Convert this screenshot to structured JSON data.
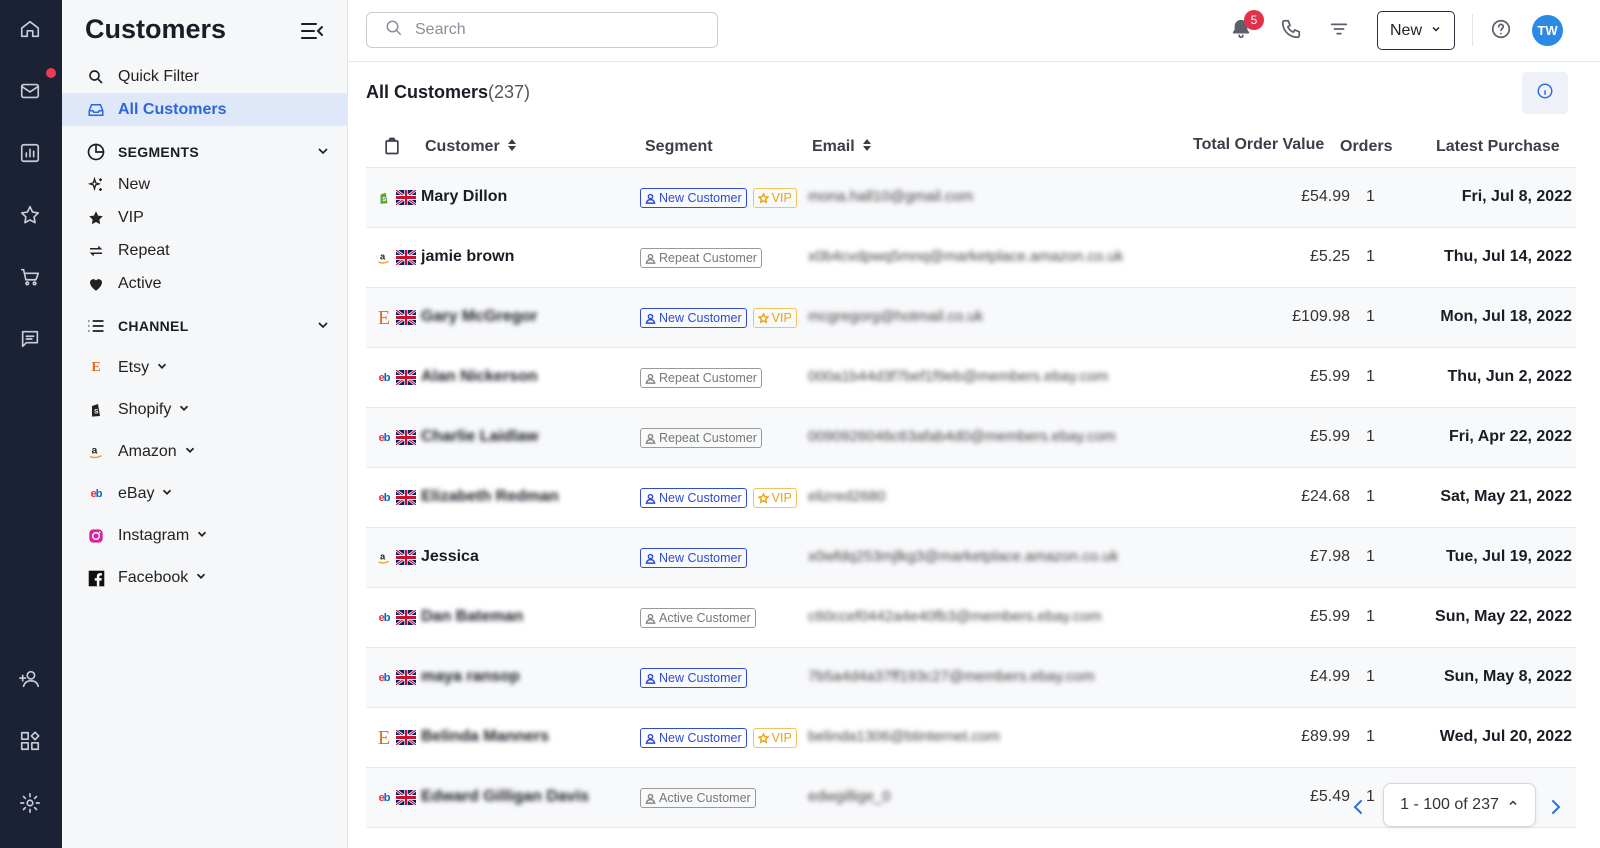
{
  "sidebar": {
    "title": "Customers",
    "quick_filter": "Quick Filter",
    "all_customers": "All Customers",
    "segments_label": "SEGMENTS",
    "segments": [
      "New",
      "VIP",
      "Repeat",
      "Active"
    ],
    "channel_label": "CHANNEL",
    "channels": [
      "Etsy",
      "Shopify",
      "Amazon",
      "eBay",
      "Instagram",
      "Facebook"
    ]
  },
  "topbar": {
    "search_placeholder": "Search",
    "notification_count": "5",
    "new_label": "New",
    "avatar_initials": "TW"
  },
  "main": {
    "heading": "All Customers",
    "count": "(237)",
    "columns": {
      "customer": "Customer",
      "segment": "Segment",
      "email": "Email",
      "total": "Total Order Value",
      "orders": "Orders",
      "latest": "Latest Purchase"
    },
    "rows": [
      {
        "channel": "shopify",
        "name": "Mary Dillon",
        "name_blur": false,
        "segments": [
          "New Customer",
          "VIP"
        ],
        "email": "mona.hall10@gmail.com",
        "total": "£54.99",
        "orders": "1",
        "latest": "Fri, Jul 8, 2022"
      },
      {
        "channel": "amazon",
        "name": "jamie brown",
        "name_blur": false,
        "segments": [
          "Repeat Customer"
        ],
        "email": "x0b4cvdpwq5mnq@marketplace.amazon.co.uk",
        "total": "£5.25",
        "orders": "1",
        "latest": "Thu, Jul 14, 2022"
      },
      {
        "channel": "etsy",
        "name": "Gary McGregor",
        "name_blur": true,
        "segments": [
          "New Customer",
          "VIP"
        ],
        "email": "mcgregorg@hotmail.co.uk",
        "total": "£109.98",
        "orders": "1",
        "latest": "Mon, Jul 18, 2022"
      },
      {
        "channel": "ebay",
        "name": "Alan Nickerson",
        "name_blur": true,
        "segments": [
          "Repeat Customer"
        ],
        "email": "000a1b44d3f7bef1f9eb@members.ebay.com",
        "total": "£5.99",
        "orders": "1",
        "latest": "Thu, Jun 2, 2022"
      },
      {
        "channel": "ebay",
        "name": "Charlie Laidlaw",
        "name_blur": true,
        "segments": [
          "Repeat Customer"
        ],
        "email": "0090926046c63afab4d0@members.ebay.com",
        "total": "£5.99",
        "orders": "1",
        "latest": "Fri, Apr 22, 2022"
      },
      {
        "channel": "ebay",
        "name": "Elizabeth Redman",
        "name_blur": true,
        "segments": [
          "New Customer",
          "VIP"
        ],
        "email": "elizred2680",
        "total": "£24.68",
        "orders": "1",
        "latest": "Sat, May 21, 2022"
      },
      {
        "channel": "amazon",
        "name": "Jessica",
        "name_blur": false,
        "segments": [
          "New Customer"
        ],
        "email": "x0wfdq253mjlkg3@marketplace.amazon.co.uk",
        "total": "£7.98",
        "orders": "1",
        "latest": "Tue, Jul 19, 2022"
      },
      {
        "channel": "ebay",
        "name": "Dan Bateman",
        "name_blur": true,
        "segments": [
          "Active Customer"
        ],
        "email": "c60ccef0442a4e40fb3@members.ebay.com",
        "total": "£5.99",
        "orders": "1",
        "latest": "Sun, May 22, 2022"
      },
      {
        "channel": "ebay",
        "name": "maya ransop",
        "name_blur": true,
        "segments": [
          "New Customer"
        ],
        "email": "7b5a4d4a37ff193c27@members.ebay.com",
        "total": "£4.99",
        "orders": "1",
        "latest": "Sun, May 8, 2022"
      },
      {
        "channel": "etsy",
        "name": "Belinda Manners",
        "name_blur": true,
        "segments": [
          "New Customer",
          "VIP"
        ],
        "email": "belinda1306@btinternet.com",
        "total": "£89.99",
        "orders": "1",
        "latest": "Wed, Jul 20, 2022"
      },
      {
        "channel": "ebay",
        "name": "Edward Gilligan Davis",
        "name_blur": true,
        "segments": [
          "Active Customer"
        ],
        "email": "edwgillige_0",
        "total": "£5.49",
        "orders": "1",
        "latest": ""
      }
    ],
    "pager": "1 - 100 of 237"
  }
}
